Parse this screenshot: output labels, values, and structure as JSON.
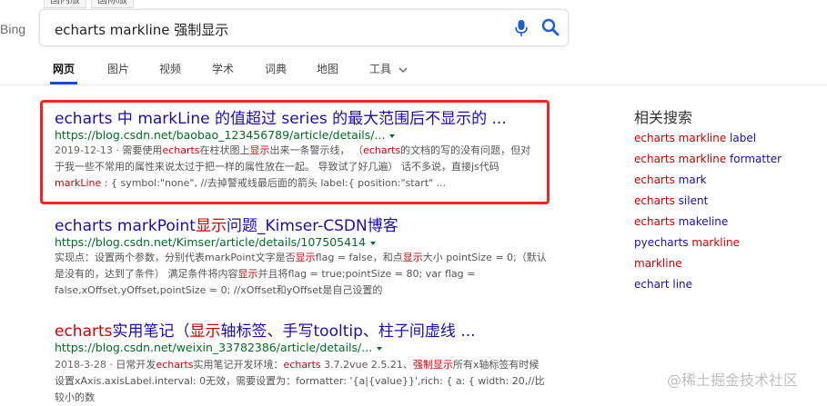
{
  "region_tabs": [
    "国内版",
    "国际版"
  ],
  "logo": "Bing",
  "search": {
    "query": "echarts markline 强制显示"
  },
  "icons": {
    "mic": "microphone-icon",
    "search": "search-icon",
    "caret": "chevron-down-icon"
  },
  "nav": [
    {
      "label": "网页",
      "active": true
    },
    {
      "label": "图片"
    },
    {
      "label": "视频"
    },
    {
      "label": "学术"
    },
    {
      "label": "词典"
    },
    {
      "label": "地图"
    },
    {
      "label": "工具"
    }
  ],
  "results": [
    {
      "title_parts": [
        {
          "t": "echarts 中 markLine 的值超过 series 的最大范围后不显示的 ...",
          "hl": false
        }
      ],
      "url": "https://blog.csdn.net/baobao_123456789/article/details/...",
      "snippet_lines": [
        [
          {
            "t": "2019-12-13",
            "c": "date"
          },
          {
            "t": " · 需要使用"
          },
          {
            "t": "echarts",
            "c": "hl"
          },
          {
            "t": "在柱状图上"
          },
          {
            "t": "显示",
            "c": "hl"
          },
          {
            "t": "出来一条警示线， （"
          },
          {
            "t": "echarts",
            "c": "hl"
          },
          {
            "t": "的文档的写的没有问题，但对"
          }
        ],
        [
          {
            "t": "于我一些不常用的属性来说太过于把一样的属性放在一起。 导致试了好几遍） 话不多说，直接js代码"
          }
        ],
        [
          {
            "t": "markLine",
            "c": "hl"
          },
          {
            "t": " : { symbol:\"none\", //去掉警戒线最后面的箭头 label:{ position:\"start\" ..."
          }
        ]
      ]
    },
    {
      "title_parts": [
        {
          "t": "echarts",
          "hl": false
        },
        {
          "t": " markPoint",
          "hl": false
        },
        {
          "t": "显示",
          "hl": true
        },
        {
          "t": "问题_Kimser-CSDN博客",
          "hl": false
        }
      ],
      "url": "https://blog.csdn.net/Kimser/article/details/107505414",
      "snippet_lines": [
        [
          {
            "t": "实现点：设置两个参数，分别代表markPoint文字是否"
          },
          {
            "t": "显示",
            "c": "hl"
          },
          {
            "t": "flag = false，和点"
          },
          {
            "t": "显示",
            "c": "hl"
          },
          {
            "t": "大小 pointSize = 0;（默认"
          }
        ],
        [
          {
            "t": "是没有的，达到了条件） 满足条件将内容"
          },
          {
            "t": "显示",
            "c": "hl"
          },
          {
            "t": "并且将flag = true;pointSize = 80; var flag ="
          }
        ],
        [
          {
            "t": "false,xOffset,yOffset,pointSize = 0; //xOffset和yOffset是自己设置的"
          }
        ]
      ]
    },
    {
      "title_parts": [
        {
          "t": "echarts",
          "hl": true
        },
        {
          "t": "实用笔记（",
          "hl": false
        },
        {
          "t": "显示",
          "hl": true
        },
        {
          "t": "轴标签、手写tooltip、柱子间虚线 ...",
          "hl": false
        }
      ],
      "url": "https://blog.csdn.net/weixin_33782386/article/details/...",
      "snippet_lines": [
        [
          {
            "t": "2018-3-28",
            "c": "date"
          },
          {
            "t": " · 日常开发"
          },
          {
            "t": "echarts",
            "c": "hl"
          },
          {
            "t": "实用笔记开发环境："
          },
          {
            "t": "echarts",
            "c": "hl"
          },
          {
            "t": " 3.7.2vue 2.5.21、"
          },
          {
            "t": "强制显示",
            "c": "hl"
          },
          {
            "t": "所有x轴标签有时候"
          }
        ],
        [
          {
            "t": "设置xAxis.axisLabel.interval: 0无效，需要设置为：formatter: '{a|{value}}',rich: { a: { width: 20,//比较小的数"
          }
        ]
      ]
    }
  ],
  "sidebar": {
    "title": "相关搜索",
    "items": [
      [
        {
          "t": "echarts markline",
          "hl": true
        },
        {
          "t": " label",
          "hl": false
        }
      ],
      [
        {
          "t": "echarts markline",
          "hl": true
        },
        {
          "t": " formatter",
          "hl": false
        }
      ],
      [
        {
          "t": "echarts",
          "hl": true
        },
        {
          "t": " mark",
          "hl": false
        }
      ],
      [
        {
          "t": "echarts",
          "hl": true
        },
        {
          "t": " silent",
          "hl": false
        }
      ],
      [
        {
          "t": "echarts",
          "hl": true
        },
        {
          "t": " makeline",
          "hl": false
        }
      ],
      [
        {
          "t": "pyecharts ",
          "hl": false
        },
        {
          "t": "markline",
          "hl": true
        }
      ],
      [
        {
          "t": "markline",
          "hl": true
        }
      ],
      [
        {
          "t": "echart line",
          "hl": false
        }
      ]
    ]
  },
  "watermark": "@稀土掘金技术社区"
}
